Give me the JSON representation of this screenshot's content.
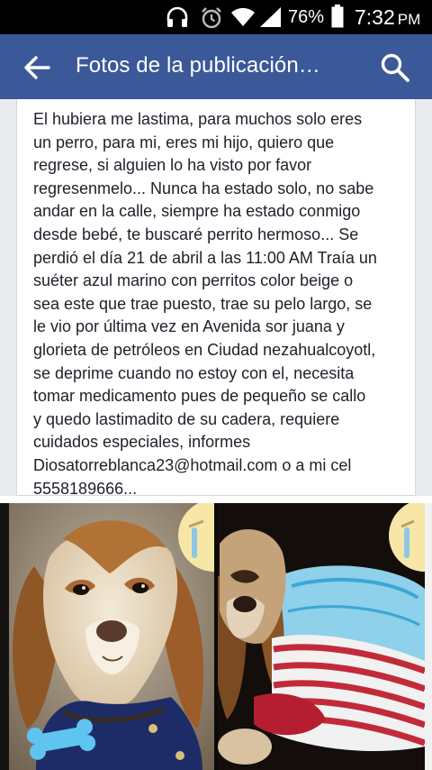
{
  "status_bar": {
    "battery_percent": "76%",
    "time": "7:32",
    "ampm": "PM",
    "icons": [
      "headphones-icon",
      "alarm-icon",
      "wifi-icon",
      "signal-icon",
      "battery-icon"
    ]
  },
  "app_bar": {
    "title": "Fotos de la publicación…",
    "back_icon": "arrow-back-icon",
    "search_icon": "search-icon",
    "color": "#3b5998"
  },
  "post": {
    "lines": [
      "El hubiera me lastima, para muchos solo eres",
      "un perro, para mi, eres mi hijo, quiero que",
      "regrese,  si alguien lo ha visto por favor",
      "regresenmelo... Nunca ha estado solo, no sabe",
      "andar en la calle,  siempre ha estado conmigo",
      "desde bebé, te buscaré perrito hermoso... Se",
      "perdió el día 21 de abril a las 11:00 AM Traía un",
      "suéter azul marino con perritos color beige o",
      "sea este que trae puesto, trae su pelo largo, se",
      "le vio por última vez en Avenida sor juana y",
      "glorieta de petróleos en Ciudad nezahualcoyotl,",
      "se deprime cuando no estoy con el, necesita",
      "tomar medicamento pues de pequeño se callo",
      "y quedo lastimadito de su cadera, requiere",
      "cuidados especiales,  informes",
      "Diosatorreblanca23@hotmail.com o a mi cel",
      "5558189666..."
    ]
  },
  "photos": [
    {
      "name": "photo-dog-sweater",
      "emoji": "crying-emoji-icon"
    },
    {
      "name": "photo-dog-striped-shirt",
      "emoji": "crying-emoji-icon"
    }
  ]
}
